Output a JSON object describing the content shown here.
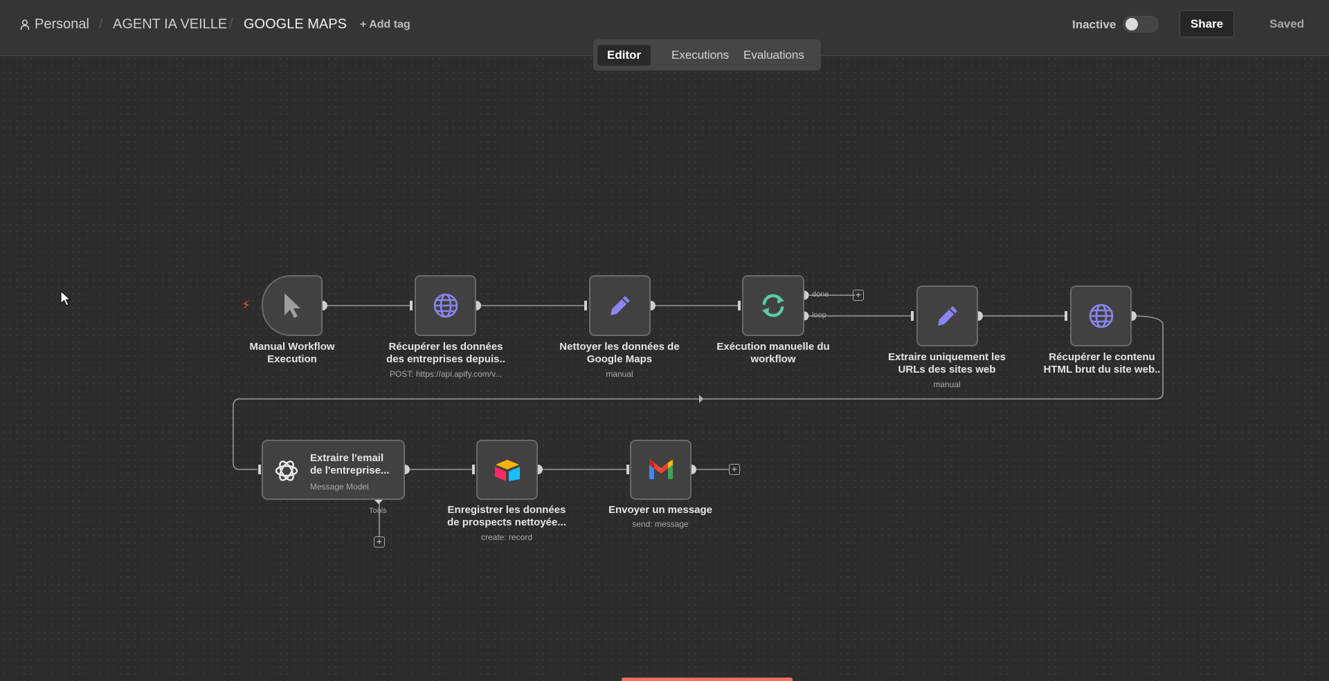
{
  "header": {
    "workspace": "Personal",
    "separator": "/",
    "project": "AGENT IA VEILLE",
    "workflow": "GOOGLE MAPS",
    "add_tag": "+ Add tag",
    "status": "Inactive",
    "share_label": "Share",
    "saved_label": "Saved"
  },
  "tabs": [
    "Editor",
    "Executions",
    "Evaluations"
  ],
  "nodes": {
    "manual": {
      "title_1": "Manual Workflow",
      "title_2": "Execution"
    },
    "fetch": {
      "title_1": "Récupérer les données",
      "title_2": "des entreprises depuis..",
      "sub": "POST: https://api.apify.com/v..."
    },
    "clean": {
      "title_1": "Nettoyer les données de",
      "title_2": "Google Maps",
      "sub": "manual"
    },
    "loop": {
      "title_1": "Exécution manuelle du",
      "title_2": "workflow",
      "done": "done",
      "loop": "loop"
    },
    "urls": {
      "title_1": "Extraire uniquement les",
      "title_2": "URLs des sites web",
      "sub": "manual"
    },
    "html": {
      "title_1": "Récupérer le contenu",
      "title_2": "HTML brut du site web.."
    },
    "email": {
      "title_1": "Extraire l'email",
      "title_2": "de l'entreprise...",
      "sub": "Message Model",
      "tools": "Tools"
    },
    "airtable": {
      "title_1": "Enregistrer les données",
      "title_2": "de prospects nettoyée...",
      "sub": "create: record"
    },
    "gmail": {
      "title_1": "Envoyer un message",
      "sub": "send: message"
    }
  },
  "plus_symbol": "+",
  "icons": [
    "person-icon",
    "cursor-icon",
    "globe-icon",
    "pencil-icon",
    "loop-icon",
    "openai-icon",
    "airtable-icon",
    "gmail-icon",
    "bolt-icon",
    "mouse-pointer-icon"
  ],
  "colors": {
    "accent": "#ff6d5a",
    "icon_purple": "#8b85f0",
    "loop_green": "#5cc9a7",
    "bolt": "#e2583e"
  }
}
